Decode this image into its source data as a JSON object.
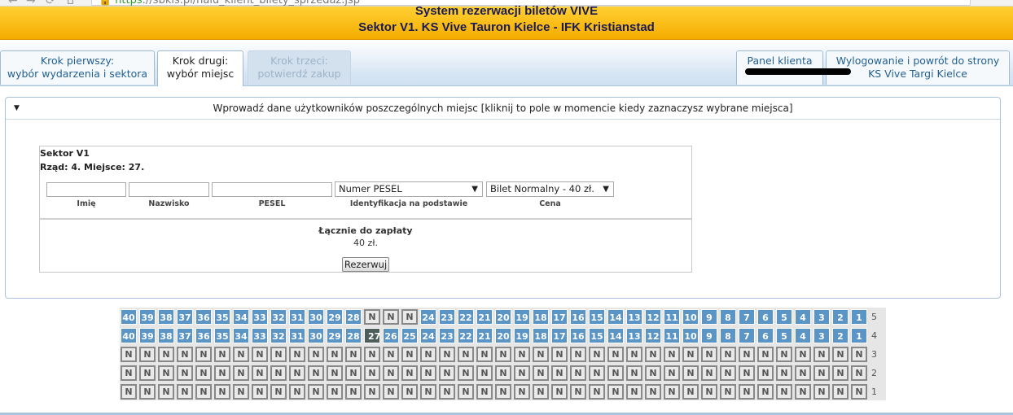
{
  "browser": {
    "url_prefix": "https",
    "url_rest": "://sbkis.pl/nalu_klient_bilety_sprzedaz.jsp",
    "nav_glyphs": [
      "←",
      "→",
      "⟳",
      "⌂"
    ]
  },
  "header": {
    "line1": "System rezerwacji biletów VIVE",
    "line2": "Sektor V1. KS Vive Tauron Kielce - IFK Kristianstad"
  },
  "tabs": [
    {
      "line1": "Krok pierwszy:",
      "line2": "wybór wydarzenia i sektora",
      "state": "normal"
    },
    {
      "line1": "Krok drugi:",
      "line2": "wybór miejsc",
      "state": "active"
    },
    {
      "line1": "Krok trzeci:",
      "line2": "potwierdź zakup",
      "state": "disabled"
    }
  ],
  "right_tabs": [
    {
      "line1": "Panel klienta",
      "line2": ""
    },
    {
      "line1": "Wylogowanie i powrót do strony",
      "line2": "KS Vive Targi Kielce"
    }
  ],
  "panel": {
    "title": "Wprowadź dane użytkowników poszczególnych miejsc [kliknij to pole w momencie kiedy zaznaczysz wybrane miejsca]",
    "collapse_glyph": "▼"
  },
  "form": {
    "sektor": "Sektor V1",
    "rzad_miejsce": "Rząd: 4. Miejsce: 27.",
    "imie_value": "",
    "nazwisko_value": "",
    "pesel_value": "",
    "identyfikacja_selected": "Numer PESEL",
    "cena_selected": "Bilet Normalny - 40 zł.",
    "labels": {
      "imie": "Imię",
      "nazwisko": "Nazwisko",
      "pesel": "PESEL",
      "identyfikacja": "Identyfikacja na podstawie",
      "cena": "Cena"
    },
    "total_label": "Łącznie do zapłaty",
    "total_value": "40 zł.",
    "submit_label": "Rezerwuj",
    "caret": "▼"
  },
  "seatmap": {
    "status_legend": {
      "free": "number shown",
      "taken": "N",
      "selected": "highlighted"
    },
    "rows": [
      {
        "row": "5",
        "seats": [
          "40",
          "39",
          "38",
          "37",
          "36",
          "35",
          "34",
          "33",
          "32",
          "31",
          "30",
          "29",
          "28",
          "N",
          "N",
          "N",
          "24",
          "23",
          "22",
          "21",
          "20",
          "19",
          "18",
          "17",
          "16",
          "15",
          "14",
          "13",
          "12",
          "11",
          "10",
          "9",
          "8",
          "7",
          "6",
          "5",
          "4",
          "3",
          "2",
          "1"
        ]
      },
      {
        "row": "4",
        "seats": [
          "40",
          "39",
          "38",
          "37",
          "36",
          "35",
          "34",
          "33",
          "32",
          "31",
          "30",
          "29",
          "28",
          "27",
          "26",
          "25",
          "24",
          "23",
          "22",
          "21",
          "20",
          "19",
          "18",
          "17",
          "16",
          "15",
          "14",
          "13",
          "12",
          "11",
          "10",
          "9",
          "8",
          "7",
          "6",
          "5",
          "4",
          "3",
          "2",
          "1"
        ],
        "selected": "27"
      },
      {
        "row": "3",
        "seats": [
          "N",
          "N",
          "N",
          "N",
          "N",
          "N",
          "N",
          "N",
          "N",
          "N",
          "N",
          "N",
          "N",
          "N",
          "N",
          "N",
          "N",
          "N",
          "N",
          "N",
          "N",
          "N",
          "N",
          "N",
          "N",
          "N",
          "N",
          "N",
          "N",
          "N",
          "N",
          "N",
          "N",
          "N",
          "N",
          "N",
          "N",
          "N",
          "N",
          "N"
        ]
      },
      {
        "row": "2",
        "seats": [
          "N",
          "N",
          "N",
          "N",
          "N",
          "N",
          "N",
          "N",
          "N",
          "N",
          "N",
          "N",
          "N",
          "N",
          "N",
          "N",
          "N",
          "N",
          "N",
          "N",
          "N",
          "N",
          "N",
          "N",
          "N",
          "N",
          "N",
          "N",
          "N",
          "N",
          "N",
          "N",
          "N",
          "N",
          "N",
          "N",
          "N",
          "N",
          "N",
          "N"
        ]
      },
      {
        "row": "1",
        "seats": [
          "N",
          "N",
          "N",
          "N",
          "N",
          "N",
          "N",
          "N",
          "N",
          "N",
          "N",
          "N",
          "N",
          "N",
          "N",
          "N",
          "N",
          "N",
          "N",
          "N",
          "N",
          "N",
          "N",
          "N",
          "N",
          "N",
          "N",
          "N",
          "N",
          "N",
          "N",
          "N",
          "N",
          "N",
          "N",
          "N",
          "N",
          "N",
          "N",
          "N"
        ]
      }
    ]
  },
  "colors": {
    "header_top": "#ffd033",
    "header_bottom": "#f5ac00",
    "seat_free": "#5b95c5",
    "seat_selected": "#4c5d5a",
    "seat_taken": "#e9e9e9",
    "tab_link": "#1f5f94"
  }
}
